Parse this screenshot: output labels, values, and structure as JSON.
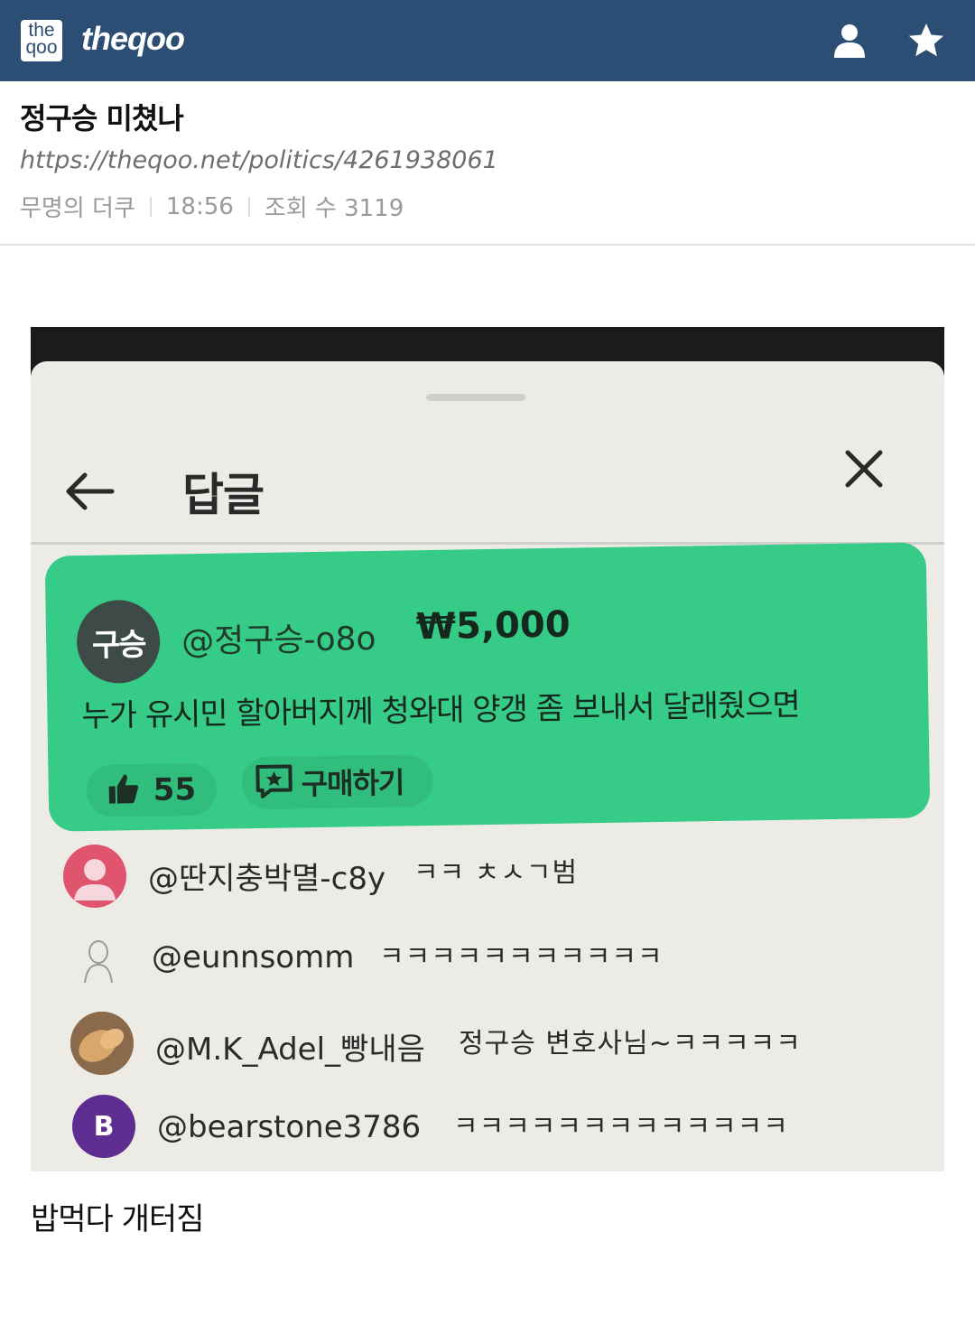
{
  "header": {
    "logo_line1": "the",
    "logo_line2": "qoo",
    "brand": "theqoo",
    "user_icon": "user-icon",
    "star_icon": "star-icon",
    "bg_color": "#2c4e74"
  },
  "post": {
    "title": "정구승 미쳤나",
    "url": "https://theqoo.net/politics/4261938061",
    "author": "무명의 더쿠",
    "time": "18:56",
    "views": "조회 수 3119"
  },
  "screenshot": {
    "sheet_title": "답글",
    "back_icon": "arrow-left-icon",
    "close_icon": "close-icon",
    "super_chat": {
      "avatar_text": "구승",
      "username": "@정구승-o8o",
      "amount": "₩5,000",
      "message": "누가 유시민 할아버지께 청와대 양갱 좀 보내서 달래줬으면",
      "likes": "55",
      "buy_label": "구매하기",
      "color": "#36cb87"
    },
    "comments": [
      {
        "username": "@딴지충박멸-c8y",
        "text": "ㅋㅋ ㅊㅅㄱ범",
        "avatar_color": "#e0546e"
      },
      {
        "username": "@eunnsomm",
        "text": "ㅋㅋㅋㅋㅋㅋㅋㅋㅋㅋㅋ",
        "avatar_color": "#ecebe6"
      },
      {
        "username": "@M.K_Adel_빵내음",
        "text": "정구승 변호사님~ㅋㅋㅋㅋㅋ",
        "avatar_color": "#c89a6a"
      },
      {
        "username": "@bearstone3786",
        "text": "ㅋㅋㅋㅋㅋㅋㅋㅋㅋㅋㅋㅋㅋ",
        "avatar_letter": "B",
        "avatar_color": "#5e2d91"
      }
    ]
  },
  "caption": "밥먹다 개터짐"
}
